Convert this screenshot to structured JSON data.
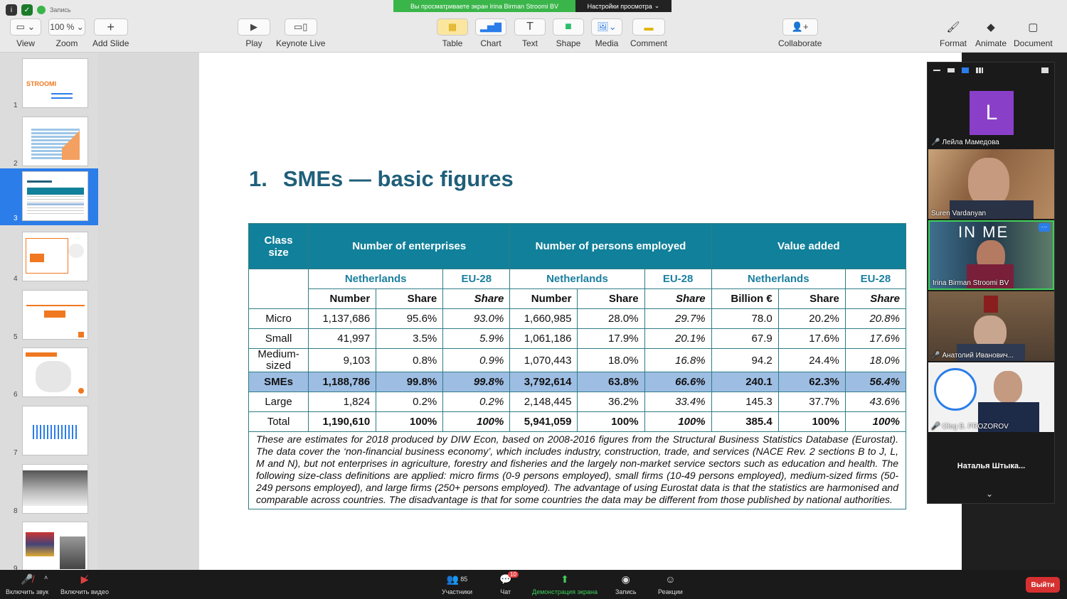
{
  "share_banner": {
    "viewing_text": "Вы просматриваете экран Irina Birman Stroomi BV",
    "view_settings": "Настройки просмотра"
  },
  "recording_label": "Запись",
  "toolbar": {
    "view": "View",
    "zoom_value": "100 %",
    "zoom": "Zoom",
    "add_slide": "Add Slide",
    "play": "Play",
    "keynote_live": "Keynote Live",
    "table": "Table",
    "chart": "Chart",
    "text": "Text",
    "shape": "Shape",
    "media": "Media",
    "comment": "Comment",
    "collaborate": "Collaborate",
    "format": "Format",
    "animate": "Animate",
    "document": "Document"
  },
  "slides": [
    {
      "num": "1",
      "caption": "STROOMI"
    },
    {
      "num": "2",
      "caption": ""
    },
    {
      "num": "3",
      "caption": ""
    },
    {
      "num": "4",
      "caption": ""
    },
    {
      "num": "5",
      "caption": ""
    },
    {
      "num": "6",
      "caption": ""
    },
    {
      "num": "7",
      "caption": ""
    },
    {
      "num": "8",
      "caption": ""
    },
    {
      "num": "9",
      "caption": ""
    }
  ],
  "slide": {
    "number": "1.",
    "title": "SMEs — basic figures",
    "table": {
      "col_class": "Class size",
      "groups": [
        "Number of enterprises",
        "Number of persons employed",
        "Value added"
      ],
      "countries": [
        "Netherlands",
        "EU-28",
        "Netherlands",
        "EU-28",
        "Netherlands",
        "EU-28"
      ],
      "subheaders": [
        "Number",
        "Share",
        "Share",
        "Number",
        "Share",
        "Share",
        "Billion €",
        "Share",
        "Share"
      ],
      "rows": [
        {
          "cls": "Micro",
          "v": [
            "1,137,686",
            "95.6%",
            "93.0%",
            "1,660,985",
            "28.0%",
            "29.7%",
            "78.0",
            "20.2%",
            "20.8%"
          ]
        },
        {
          "cls": "Small",
          "v": [
            "41,997",
            "3.5%",
            "5.9%",
            "1,061,186",
            "17.9%",
            "20.1%",
            "67.9",
            "17.6%",
            "17.6%"
          ]
        },
        {
          "cls": "Medium-sized",
          "v": [
            "9,103",
            "0.8%",
            "0.9%",
            "1,070,443",
            "18.0%",
            "16.8%",
            "94.2",
            "24.4%",
            "18.0%"
          ]
        },
        {
          "cls": "SMEs",
          "v": [
            "1,188,786",
            "99.8%",
            "99.8%",
            "3,792,614",
            "63.8%",
            "66.6%",
            "240.1",
            "62.3%",
            "56.4%"
          ]
        },
        {
          "cls": "Large",
          "v": [
            "1,824",
            "0.2%",
            "0.2%",
            "2,148,445",
            "36.2%",
            "33.4%",
            "145.3",
            "37.7%",
            "43.6%"
          ]
        },
        {
          "cls": "Total",
          "v": [
            "1,190,610",
            "100%",
            "100%",
            "5,941,059",
            "100%",
            "100%",
            "385.4",
            "100%",
            "100%"
          ]
        }
      ],
      "note": "These are estimates for 2018 produced by DIW Econ, based on 2008-2016 figures from the Structural Business Statistics Database (Eurostat). The data cover the ‘non-financial business economy’, which includes industry, construction, trade, and services (NACE Rev. 2 sections B to J, L, M and N), but not enterprises in agriculture, forestry and fisheries and the largely non-market service sectors such as education and health. The following size-class definitions are applied: micro firms (0-9 persons employed), small firms (10-49 persons employed), medium-sized firms (50-249 persons employed), and large firms (250+ persons employed). The advantage of using Eurostat data is that the statistics are harmonised and comparable across countries. The disadvantage is that for some countries the data may be different from those published by national authorities."
    }
  },
  "participants": [
    {
      "name": "Лейла Мамедова",
      "initial": "L",
      "muted": true
    },
    {
      "name": "Suren Vardanyan",
      "muted": false
    },
    {
      "name": "Irina Birman Stroomi BV",
      "muted": false
    },
    {
      "name": "Анатолий Иванович...",
      "muted": true
    },
    {
      "name": "Oleg B. PROZOROV",
      "muted": true
    },
    {
      "name": "Наталья  Штыка...",
      "muted": false
    }
  ],
  "bottombar": {
    "unmute": "Включить звук",
    "start_video": "Включить видео",
    "participants_count": "85",
    "participants": "Участники",
    "chat_badge": "10",
    "chat": "Чат",
    "share_screen": "Демонстрация экрана",
    "record": "Запись",
    "reactions": "Реакции",
    "leave": "Выйти"
  },
  "colors": {
    "accent": "#11809a",
    "title": "#1f5f7a",
    "sme_row": "#9dbde3",
    "selected_slide": "#2b7de9",
    "exit": "#d63030"
  }
}
